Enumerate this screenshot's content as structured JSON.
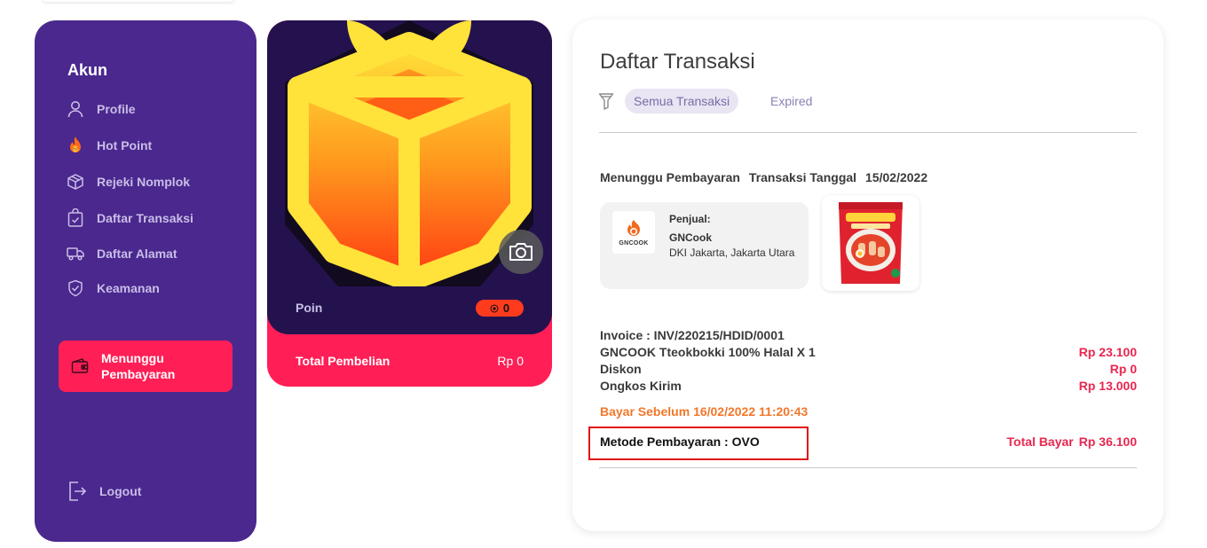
{
  "sidebar": {
    "title": "Akun",
    "items": [
      {
        "label": "Profile",
        "icon": "user-icon"
      },
      {
        "label": "Hot Point",
        "icon": "fire-icon"
      },
      {
        "label": "Rejeki Nomplok",
        "icon": "gift-box-icon"
      },
      {
        "label": "Daftar Transaksi",
        "icon": "shopping-bag-icon"
      },
      {
        "label": "Daftar Alamat",
        "icon": "truck-icon"
      },
      {
        "label": "Keamanan",
        "icon": "shield-icon"
      }
    ],
    "active": {
      "label": "Menunggu Pembayaran",
      "icon": "wallet-icon"
    },
    "logout": {
      "label": "Logout",
      "icon": "logout-icon"
    }
  },
  "profile_card": {
    "poin_label": "Poin",
    "poin_value": "0",
    "total_label": "Total Pembelian",
    "total_value": "Rp 0"
  },
  "main": {
    "title": "Daftar Transaksi",
    "filters": [
      "Semua Transaksi",
      "Expired"
    ],
    "transaction": {
      "status": "Menunggu Pembayaran",
      "date_label": "Transaksi Tanggal",
      "date": "15/02/2022",
      "seller_label": "Penjual:",
      "seller_name": "GNCook",
      "seller_location": "DKI Jakarta, Jakarta Utara",
      "seller_logo_text": "GNCOOK",
      "invoice": "Invoice : INV/220215/HDID/0001",
      "item_name": "GNCOOK Tteokbokki 100% Halal X 1",
      "item_price": "Rp 23.100",
      "discount_label": "Diskon",
      "discount_value": "Rp 0",
      "shipping_label": "Ongkos Kirim",
      "shipping_value": "Rp 13.000",
      "pay_before_label": "Bayar Sebelum",
      "pay_before_value": "16/02/2022 11:20:43",
      "method": "Metode Pembayaran : OVO",
      "total_label": "Total Bayar",
      "total_value": "Rp 36.100"
    }
  },
  "colors": {
    "sidebar_bg": "#4a288e",
    "accent_pink": "#ff1f56",
    "price_red": "#e8264f",
    "warning_orange": "#f2772a"
  }
}
